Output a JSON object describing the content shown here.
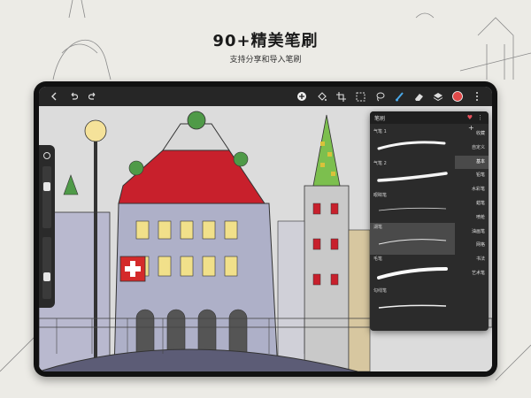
{
  "headline": "90+精美笔刷",
  "subline": "支持分享和导入笔刷",
  "toolbar": {
    "left_icons": [
      "back-icon",
      "undo-icon",
      "redo-icon"
    ],
    "right_icons": [
      "add-icon",
      "fill-icon",
      "crop-icon",
      "select-icon",
      "lasso-icon",
      "brush-icon",
      "eraser-icon",
      "layers-icon",
      "color-swatch",
      "more-icon"
    ],
    "active_color": "#e04a4a",
    "brush_color": "#4aa8e8"
  },
  "brush_panel": {
    "title": "笔刷",
    "brushes": [
      {
        "name": "气笔 1"
      },
      {
        "name": "气笔 2"
      },
      {
        "name": "眼睛笔"
      },
      {
        "name": "湖笔"
      },
      {
        "name": "毛笔"
      },
      {
        "name": "勾线笔"
      }
    ],
    "selected_brush_index": 3,
    "categories": [
      "收藏",
      "自定义",
      "基本",
      "铅笔",
      "水彩笔",
      "蜡笔",
      "喷枪",
      "油画笔",
      "网格",
      "书法",
      "艺术笔"
    ],
    "active_category_index": 2
  }
}
